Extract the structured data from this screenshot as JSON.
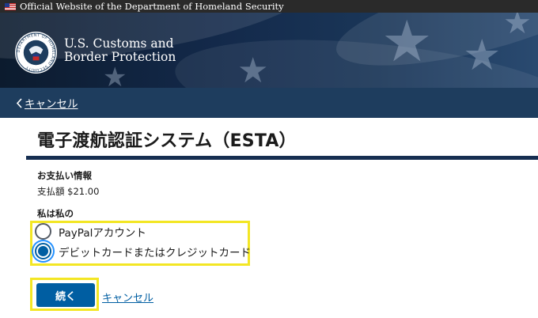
{
  "banner": {
    "text": "Official Website of the Department of Homeland Security",
    "flag_icon": "us-flag-icon"
  },
  "header": {
    "agency_line1": "U.S. Customs and",
    "agency_line2": "Border Protection",
    "seal_icon": "dhs-seal-icon",
    "seal_ring_text": "DEPARTMENT OF HOMELAND SECURITY"
  },
  "nav": {
    "cancel_label": "キャンセル",
    "chevron_icon": "chevron-left-icon"
  },
  "page": {
    "title": "電子渡航認証システム（ESTA）"
  },
  "payment": {
    "section_title": "お支払い情報",
    "amount_text": "支払額 $21.00"
  },
  "method": {
    "label": "私は私の",
    "options": [
      {
        "label": "PayPalアカウント",
        "selected": false
      },
      {
        "label": "デビットカードまたはクレジットカード",
        "selected": true
      }
    ]
  },
  "actions": {
    "continue_label": "続く",
    "cancel_label": "キャンセル"
  },
  "colors": {
    "primary": "#005ea2",
    "nav_bg": "#1e3d5e",
    "title_rule": "#162e51",
    "highlight": "#f3e624"
  }
}
